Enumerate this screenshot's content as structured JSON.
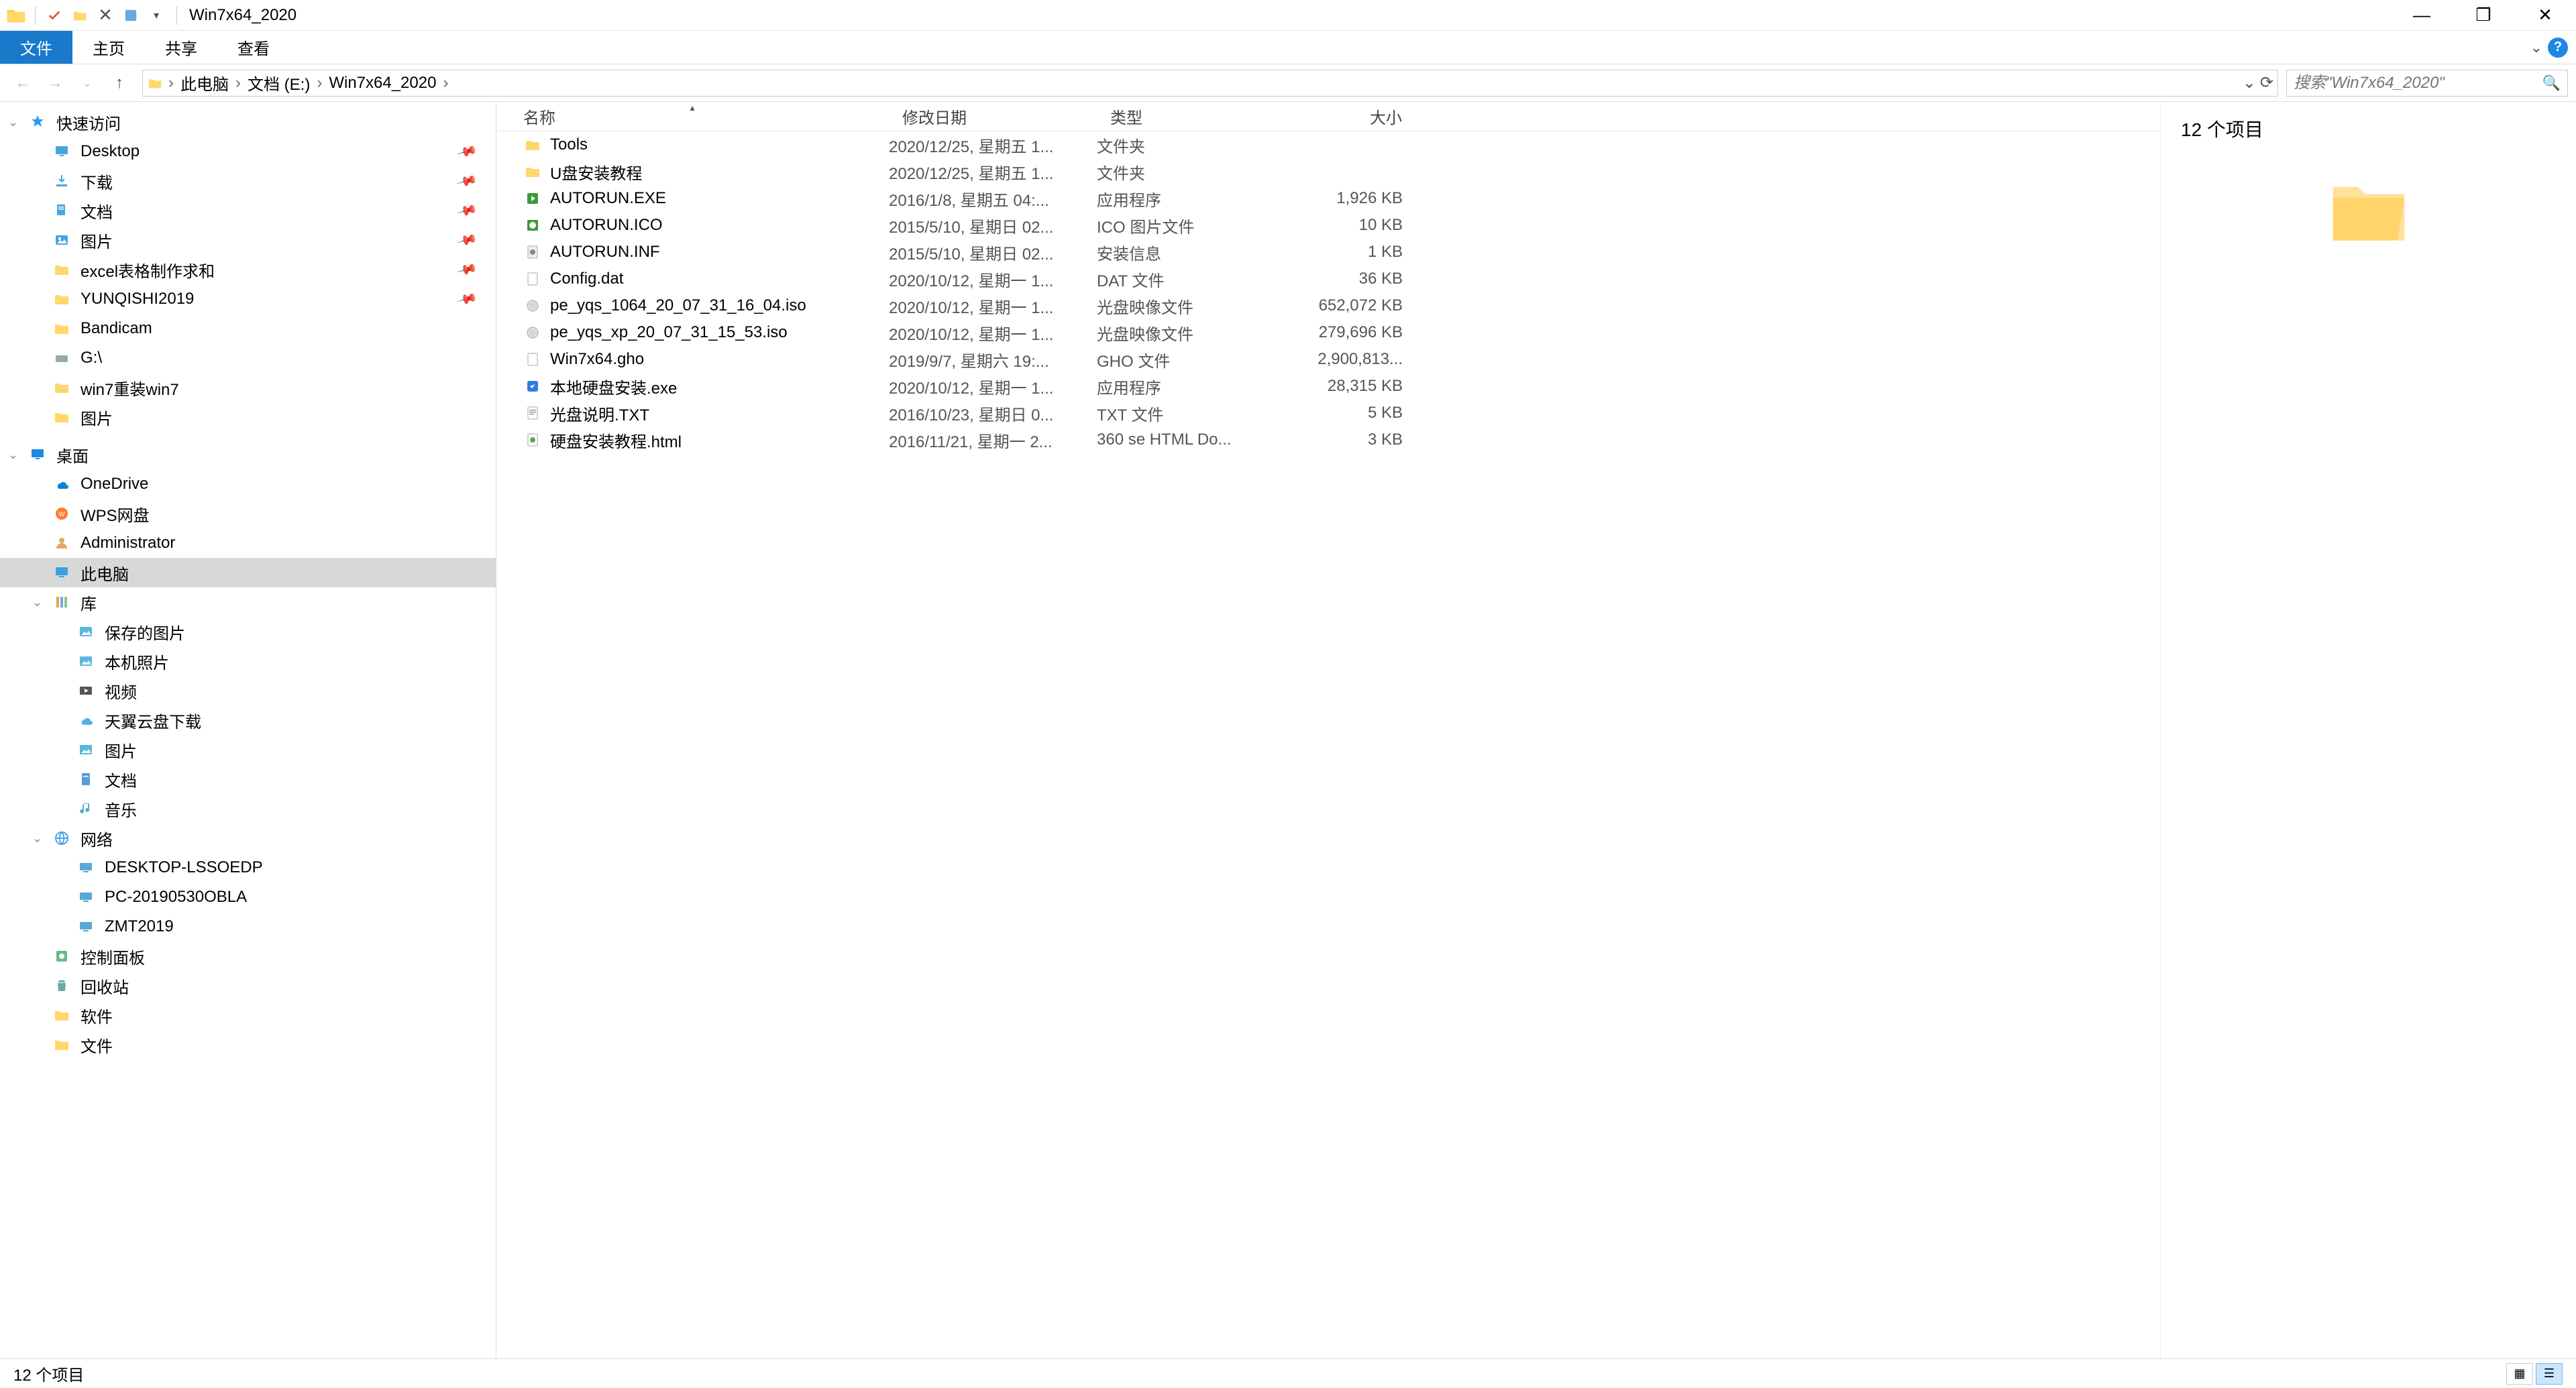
{
  "window": {
    "title": "Win7x64_2020"
  },
  "ribbon": {
    "tabs": [
      "文件",
      "主页",
      "共享",
      "查看"
    ],
    "activeIndex": 0
  },
  "nav": {
    "breadcrumb": [
      "此电脑",
      "文档 (E:)",
      "Win7x64_2020"
    ],
    "search_placeholder": "搜索\"Win7x64_2020\""
  },
  "sidebar": {
    "groups": [
      {
        "label": "快速访问",
        "icon": "star",
        "level": 1,
        "expanded": true,
        "children": [
          {
            "label": "Desktop",
            "icon": "desktop",
            "pinned": true
          },
          {
            "label": "下载",
            "icon": "downloads",
            "pinned": true
          },
          {
            "label": "文档",
            "icon": "documents",
            "pinned": true
          },
          {
            "label": "图片",
            "icon": "pictures",
            "pinned": true
          },
          {
            "label": "excel表格制作求和",
            "icon": "folder",
            "pinned": true
          },
          {
            "label": "YUNQISHI2019",
            "icon": "folder",
            "pinned": true
          },
          {
            "label": "Bandicam",
            "icon": "folder"
          },
          {
            "label": "G:\\",
            "icon": "drive"
          },
          {
            "label": "win7重装win7",
            "icon": "folder"
          },
          {
            "label": "图片",
            "icon": "folder"
          }
        ]
      },
      {
        "label": "桌面",
        "icon": "desktop-blue",
        "level": 1,
        "expanded": true,
        "children": [
          {
            "label": "OneDrive",
            "icon": "onedrive"
          },
          {
            "label": "WPS网盘",
            "icon": "wps"
          },
          {
            "label": "Administrator",
            "icon": "user"
          },
          {
            "label": "此电脑",
            "icon": "pc",
            "selected": true
          },
          {
            "label": "库",
            "icon": "library",
            "expanded": true,
            "children": [
              {
                "label": "保存的图片",
                "icon": "pic"
              },
              {
                "label": "本机照片",
                "icon": "pic"
              },
              {
                "label": "视频",
                "icon": "video"
              },
              {
                "label": "天翼云盘下载",
                "icon": "cloud"
              },
              {
                "label": "图片",
                "icon": "pic"
              },
              {
                "label": "文档",
                "icon": "doc"
              },
              {
                "label": "音乐",
                "icon": "music"
              }
            ]
          },
          {
            "label": "网络",
            "icon": "network",
            "expanded": true,
            "children": [
              {
                "label": "DESKTOP-LSSOEDP",
                "icon": "computer"
              },
              {
                "label": "PC-20190530OBLA",
                "icon": "computer"
              },
              {
                "label": "ZMT2019",
                "icon": "computer"
              }
            ]
          },
          {
            "label": "控制面板",
            "icon": "control"
          },
          {
            "label": "回收站",
            "icon": "recycle"
          },
          {
            "label": "软件",
            "icon": "folder"
          },
          {
            "label": "文件",
            "icon": "folder"
          }
        ]
      }
    ]
  },
  "columns": {
    "name": "名称",
    "date": "修改日期",
    "type": "类型",
    "size": "大小"
  },
  "files": [
    {
      "name": "Tools",
      "date": "2020/12/25, 星期五 1...",
      "type": "文件夹",
      "size": "",
      "icon": "folder"
    },
    {
      "name": "U盘安装教程",
      "date": "2020/12/25, 星期五 1...",
      "type": "文件夹",
      "size": "",
      "icon": "folder"
    },
    {
      "name": "AUTORUN.EXE",
      "date": "2016/1/8, 星期五 04:...",
      "type": "应用程序",
      "size": "1,926 KB",
      "icon": "exe-green"
    },
    {
      "name": "AUTORUN.ICO",
      "date": "2015/5/10, 星期日 02...",
      "type": "ICO 图片文件",
      "size": "10 KB",
      "icon": "ico"
    },
    {
      "name": "AUTORUN.INF",
      "date": "2015/5/10, 星期日 02...",
      "type": "安装信息",
      "size": "1 KB",
      "icon": "inf"
    },
    {
      "name": "Config.dat",
      "date": "2020/10/12, 星期一 1...",
      "type": "DAT 文件",
      "size": "36 KB",
      "icon": "file"
    },
    {
      "name": "pe_yqs_1064_20_07_31_16_04.iso",
      "date": "2020/10/12, 星期一 1...",
      "type": "光盘映像文件",
      "size": "652,072 KB",
      "icon": "iso"
    },
    {
      "name": "pe_yqs_xp_20_07_31_15_53.iso",
      "date": "2020/10/12, 星期一 1...",
      "type": "光盘映像文件",
      "size": "279,696 KB",
      "icon": "iso"
    },
    {
      "name": "Win7x64.gho",
      "date": "2019/9/7, 星期六 19:...",
      "type": "GHO 文件",
      "size": "2,900,813...",
      "icon": "file"
    },
    {
      "name": "本地硬盘安装.exe",
      "date": "2020/10/12, 星期一 1...",
      "type": "应用程序",
      "size": "28,315 KB",
      "icon": "exe-blue"
    },
    {
      "name": "光盘说明.TXT",
      "date": "2016/10/23, 星期日 0...",
      "type": "TXT 文件",
      "size": "5 KB",
      "icon": "txt"
    },
    {
      "name": "硬盘安装教程.html",
      "date": "2016/11/21, 星期一 2...",
      "type": "360 se HTML Do...",
      "size": "3 KB",
      "icon": "html"
    }
  ],
  "preview": {
    "title": "12 个项目"
  },
  "statusbar": {
    "text": "12 个项目"
  }
}
